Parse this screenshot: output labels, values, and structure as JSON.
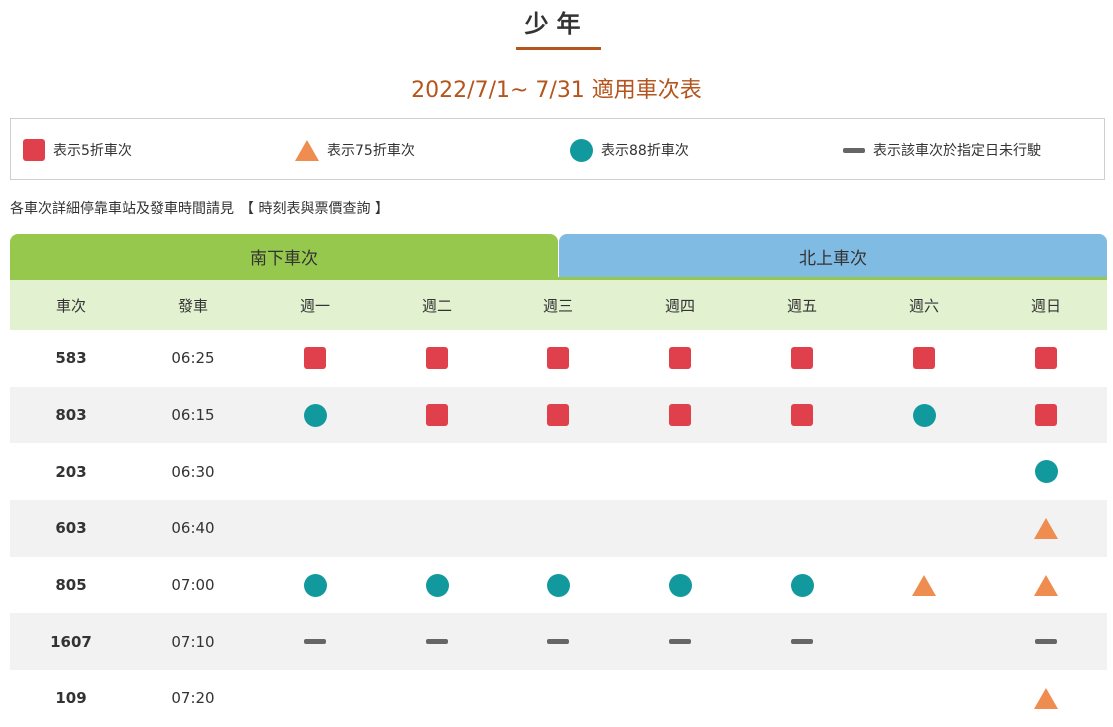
{
  "page": {
    "title": "少年",
    "subtitle": "2022/7/1~ 7/31 適用車次表"
  },
  "legend": [
    {
      "symbol": "square",
      "label": "表示5折車次"
    },
    {
      "symbol": "triangle",
      "label": "表示75折車次"
    },
    {
      "symbol": "circle",
      "label": "表示88折車次"
    },
    {
      "symbol": "dash",
      "label": "表示該車次於指定日未行駛"
    }
  ],
  "colors": {
    "square": "#e0404c",
    "triangle": "#ef8c4f",
    "circle": "#11999e",
    "dash": "#666666",
    "accent": "#b5541c",
    "tab_south": "#96c84d",
    "tab_north": "#7fbbe3",
    "header_bg": "#e2f1d0"
  },
  "note": {
    "text": "各車次詳細停靠車站及發車時間請見",
    "link": "【 時刻表與票價查詢 】"
  },
  "tabs": {
    "south": "南下車次",
    "north": "北上車次"
  },
  "table": {
    "headers": [
      "車次",
      "發車",
      "週一",
      "週二",
      "週三",
      "週四",
      "週五",
      "週六",
      "週日"
    ],
    "rows": [
      {
        "train": "583",
        "dep": "06:25",
        "days": [
          "square",
          "square",
          "square",
          "square",
          "square",
          "square",
          "square"
        ]
      },
      {
        "train": "803",
        "dep": "06:15",
        "days": [
          "circle",
          "square",
          "square",
          "square",
          "square",
          "circle",
          "square"
        ]
      },
      {
        "train": "203",
        "dep": "06:30",
        "days": [
          "",
          "",
          "",
          "",
          "",
          "",
          "circle"
        ]
      },
      {
        "train": "603",
        "dep": "06:40",
        "days": [
          "",
          "",
          "",
          "",
          "",
          "",
          "triangle"
        ]
      },
      {
        "train": "805",
        "dep": "07:00",
        "days": [
          "circle",
          "circle",
          "circle",
          "circle",
          "circle",
          "triangle",
          "triangle"
        ]
      },
      {
        "train": "1607",
        "dep": "07:10",
        "days": [
          "dash",
          "dash",
          "dash",
          "dash",
          "dash",
          "",
          "dash"
        ]
      },
      {
        "train": "109",
        "dep": "07:20",
        "days": [
          "",
          "",
          "",
          "",
          "",
          "",
          "triangle"
        ]
      }
    ]
  }
}
